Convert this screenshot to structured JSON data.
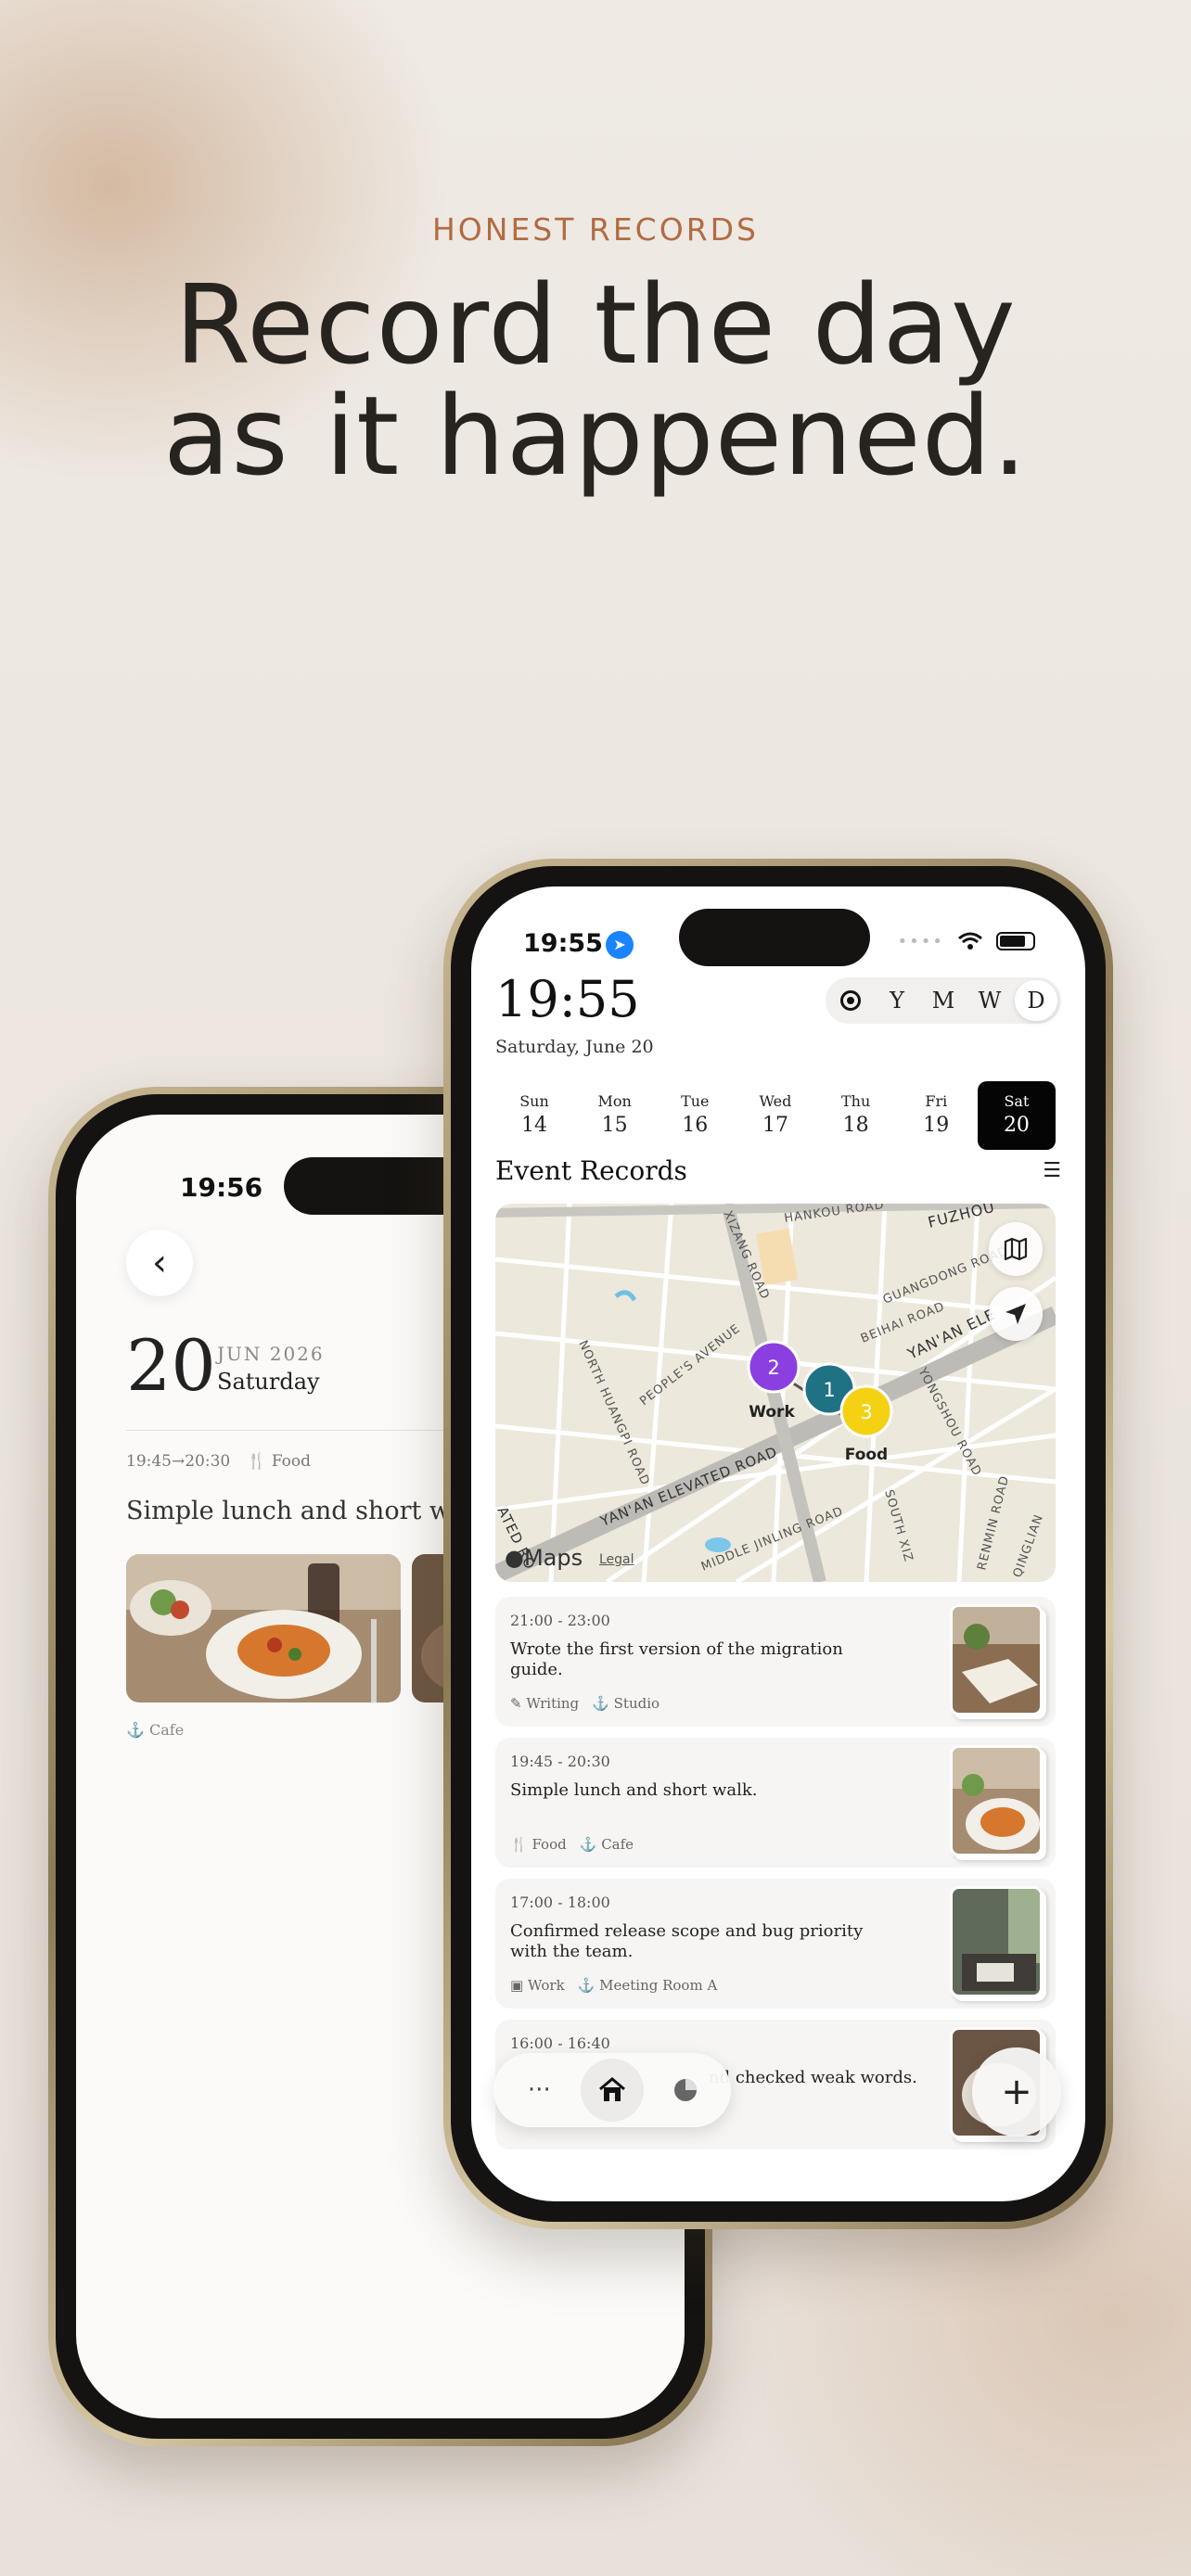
{
  "hero": {
    "eyebrow": "HONEST RECORDS",
    "headline_line1": "Record the day",
    "headline_line2": "as it happened."
  },
  "back_phone": {
    "status_time": "19:56",
    "day": "20",
    "month_year": "JUN 2026",
    "weekday": "Saturday",
    "meta_time": "19:45→20:30",
    "meta_tag": "Food",
    "entry_title": "Simple lunch and short walk.",
    "place": "Cafe"
  },
  "front_phone": {
    "status_time": "19:55",
    "big_time": "19:55",
    "date_line": "Saturday, June 20",
    "range_options": [
      "Y",
      "M",
      "W",
      "D"
    ],
    "range_selected": "D",
    "week": [
      {
        "wd": "Sun",
        "dn": "14"
      },
      {
        "wd": "Mon",
        "dn": "15"
      },
      {
        "wd": "Tue",
        "dn": "16"
      },
      {
        "wd": "Wed",
        "dn": "17"
      },
      {
        "wd": "Thu",
        "dn": "18"
      },
      {
        "wd": "Fri",
        "dn": "19"
      },
      {
        "wd": "Sat",
        "dn": "20"
      }
    ],
    "section_title": "Event Records",
    "map": {
      "streets": [
        "HANKOU ROAD",
        "FUZHOU",
        "XIZANG ROAD",
        "GUANGDONG ROAD",
        "BEIHAI ROAD",
        "YAN'AN ELE",
        "PEOPLE'S AVENUE",
        "NORTH HUANGPI ROAD",
        "YONGSHOU ROAD",
        "YAN'AN ELEVATED ROAD",
        "MIDDLE JINLING ROAD",
        "SOUTH XIZ",
        "RENMIN ROAD",
        "QINGLIAN",
        "ATED RO"
      ],
      "pins": [
        {
          "num": "1",
          "label": "",
          "color": "#1f7283"
        },
        {
          "num": "2",
          "label": "Work",
          "color": "#8b3fe0"
        },
        {
          "num": "3",
          "label": "Food",
          "color": "#f5d114"
        }
      ],
      "attribution": "Maps",
      "legal": "Legal"
    },
    "records": [
      {
        "time": "21:00 - 23:00",
        "title": "Wrote the first version of the migration guide.",
        "tag1": "Writing",
        "tag2": "Studio"
      },
      {
        "time": "19:45 - 20:30",
        "title": "Simple lunch and short walk.",
        "tag1": "Food",
        "tag2": "Cafe"
      },
      {
        "time": "17:00 - 18:00",
        "title": "Confirmed release scope and bug priority with the team.",
        "tag1": "Work",
        "tag2": "Meeting Room A"
      },
      {
        "time": "16:00 - 16:40",
        "title": "nd checked weak words.",
        "tag1": "",
        "tag2": ""
      }
    ],
    "tabbar": {
      "more": "···",
      "home": "home-icon",
      "stats": "pie-icon"
    },
    "fab": "+"
  },
  "colors": {
    "accent": "#b36b43",
    "ink": "#272420"
  }
}
